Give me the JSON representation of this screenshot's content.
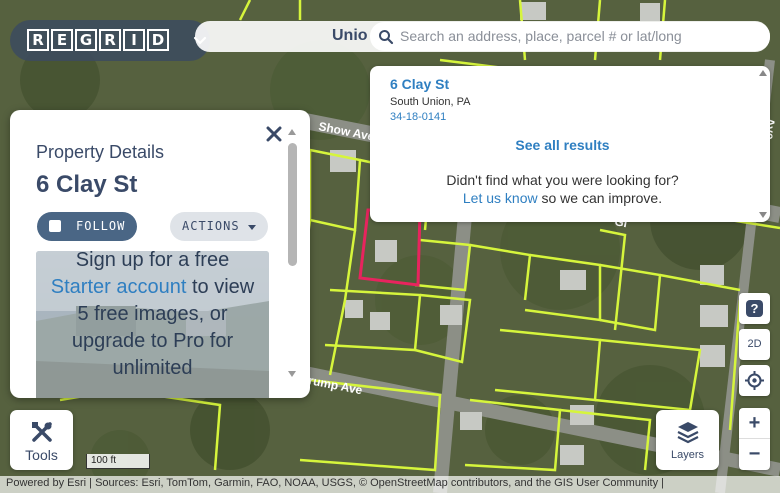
{
  "header": {
    "logo_letters": [
      "R",
      "E",
      "G",
      "R",
      "I",
      "D"
    ],
    "place_label": "Unio",
    "search_placeholder": "Search an address, place, parcel # or lat/long"
  },
  "map": {
    "street_labels": [
      "Show Ave",
      "rump Ave",
      "Gl"
    ],
    "side_street_label": "Ave",
    "parcel_line_color": "#d6f53c",
    "selected_parcel_color": "#e8245e"
  },
  "search_results": {
    "item": {
      "title": "6 Clay St",
      "subtitle": "South Union, PA",
      "parcel_id": "34-18-0141"
    },
    "see_all": "See all results",
    "not_found": "Didn't find what you were looking for?",
    "help_link": "Let us know",
    "help_suffix": " so we can improve."
  },
  "property_panel": {
    "heading": "Property Details",
    "address": "6 Clay St",
    "follow_label": "FOLLOW",
    "actions_label": "ACTIONS",
    "promo": {
      "line1": "Sign up for a free",
      "link": "Starter account",
      "line2": " to view 5 free images, or upgrade to Pro for unlimited"
    }
  },
  "tools": {
    "label": "Tools"
  },
  "layers": {
    "label": "Layers"
  },
  "controls": {
    "two_d_label": "2D",
    "zoom_in": "+",
    "zoom_out": "−"
  },
  "scale": {
    "label": "100 ft"
  },
  "attribution": {
    "powered_by": "Powered by ",
    "esri": "Esri",
    "sources": " | Sources: Esri, TomTom, Garmin, FAO, NOAA, USGS, © ",
    "osm": "OpenStreetMap",
    "contributors": " contributors, and the ",
    "gis": "GIS User Community",
    "tail": " |"
  },
  "colors": {
    "brand_dark": "#3a4a68",
    "link_blue": "#2f7fc1",
    "follow_bg": "#4a6685"
  }
}
